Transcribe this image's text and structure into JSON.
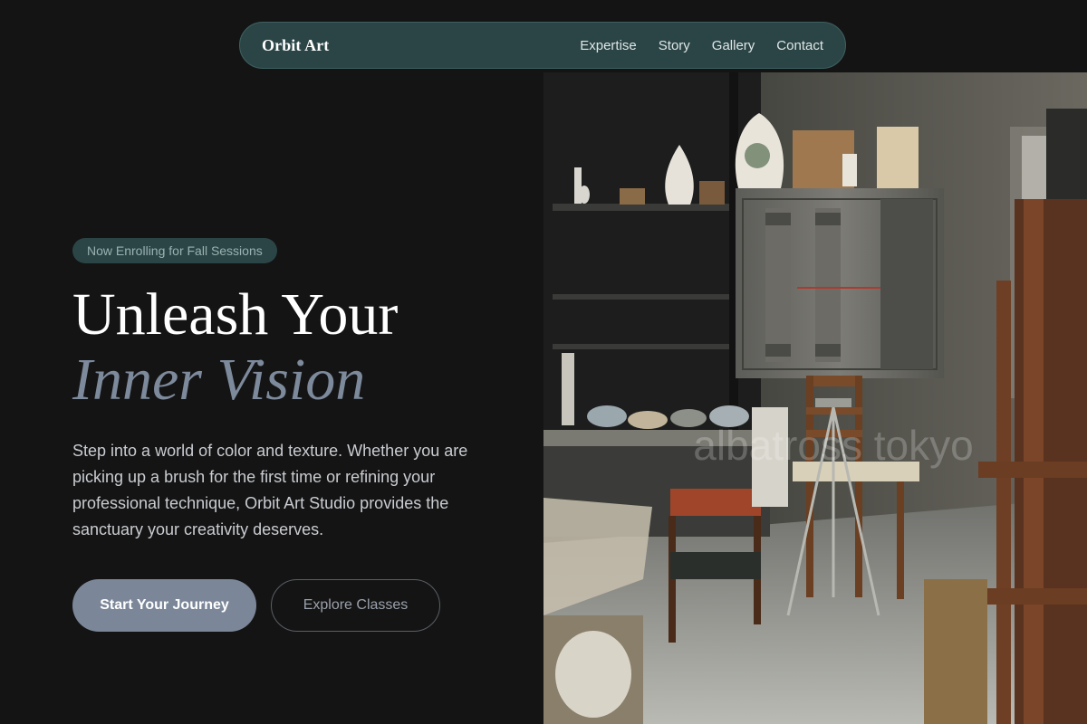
{
  "nav": {
    "brand": "Orbit Art",
    "links": [
      "Expertise",
      "Story",
      "Gallery",
      "Contact"
    ]
  },
  "hero": {
    "badge": "Now Enrolling for Fall Sessions",
    "headline_line1": "Unleash Your",
    "headline_line2": "Inner Vision",
    "description": "Step into a world of color and texture. Whether you are picking up a brush for the first time or refining your professional technique, Orbit Art Studio provides the sanctuary your creativity deserves.",
    "primary_cta": "Start Your Journey",
    "secondary_cta": "Explore Classes",
    "image": {
      "alt": "Cluttered ceramics studio with kiln, shelves of pottery and wooden chairs",
      "watermark": "albatross tokyo"
    }
  },
  "colors": {
    "background": "#141414",
    "nav_bg": "#2b4546",
    "accent_muted": "#7d8a9c",
    "primary_button": "#7b8799"
  }
}
